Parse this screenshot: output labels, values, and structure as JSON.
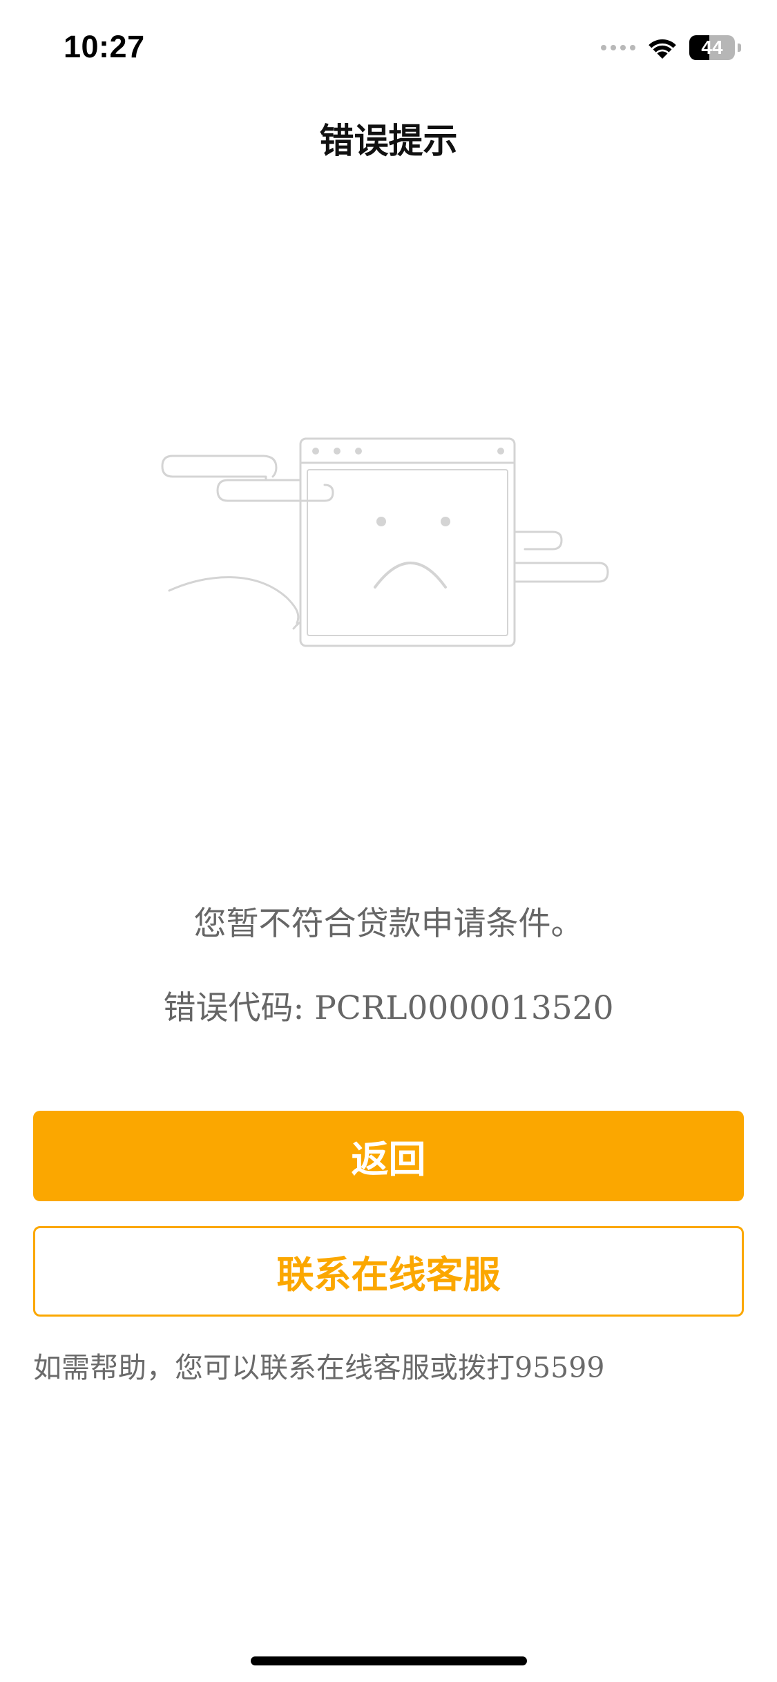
{
  "status_bar": {
    "time": "10:27",
    "battery_level": "44",
    "battery_fraction": 0.44,
    "icons": [
      "signal-dots-icon",
      "wifi-icon",
      "battery-icon"
    ]
  },
  "nav": {
    "title": "错误提示"
  },
  "illustration": {
    "icon": "sad-browser-window-icon"
  },
  "messages": {
    "main": "您暂不符合贷款申请条件。",
    "code": "错误代码: PCRL0000013520"
  },
  "buttons": {
    "back_label": "返回",
    "service_label": "联系在线客服"
  },
  "help_text": "如需帮助，您可以联系在线客服或拨打95599",
  "colors": {
    "accent": "#fba700",
    "text_muted": "#666666",
    "illustration_stroke": "#d4d4d4"
  }
}
